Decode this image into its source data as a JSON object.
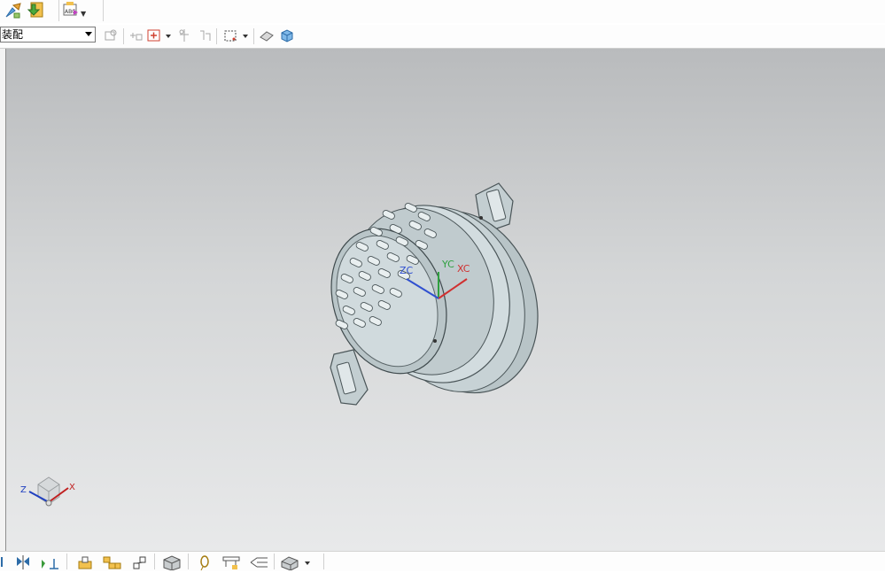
{
  "top_toolbar": {
    "buttons": [
      "assembly-constraints-icon",
      "save-assembly-icon",
      "text-annotation-icon"
    ]
  },
  "selection_bar": {
    "filter_value": "装配",
    "icons": [
      "selection-scope-icon",
      "snap-point-icon",
      "add-component-icon",
      "move-icon",
      "repositon-icon",
      "selection-box-icon",
      "eraser-icon",
      "shaded-cube-icon"
    ]
  },
  "viewport": {
    "wcs_labels": {
      "zc": "ZC",
      "yc": "YC",
      "xc": "XC"
    },
    "triad_labels": {
      "z": "Z",
      "x": "X"
    }
  },
  "bottom_toolbar": {
    "icons": [
      "hinge-icon",
      "mirror-icon",
      "axis-icon",
      "pattern-icon",
      "assembly-icon",
      "section-icon",
      "box-view-icon",
      "lasso-icon",
      "clamp-icon",
      "tree-icon",
      "shaded-part-icon"
    ]
  },
  "colors": {
    "viewport_top": "#b9bbbd",
    "viewport_bottom": "#e8e9ea",
    "model": "#c5d0d3",
    "axis_x": "#d03030",
    "axis_y": "#30a040",
    "axis_z": "#3050d0"
  }
}
